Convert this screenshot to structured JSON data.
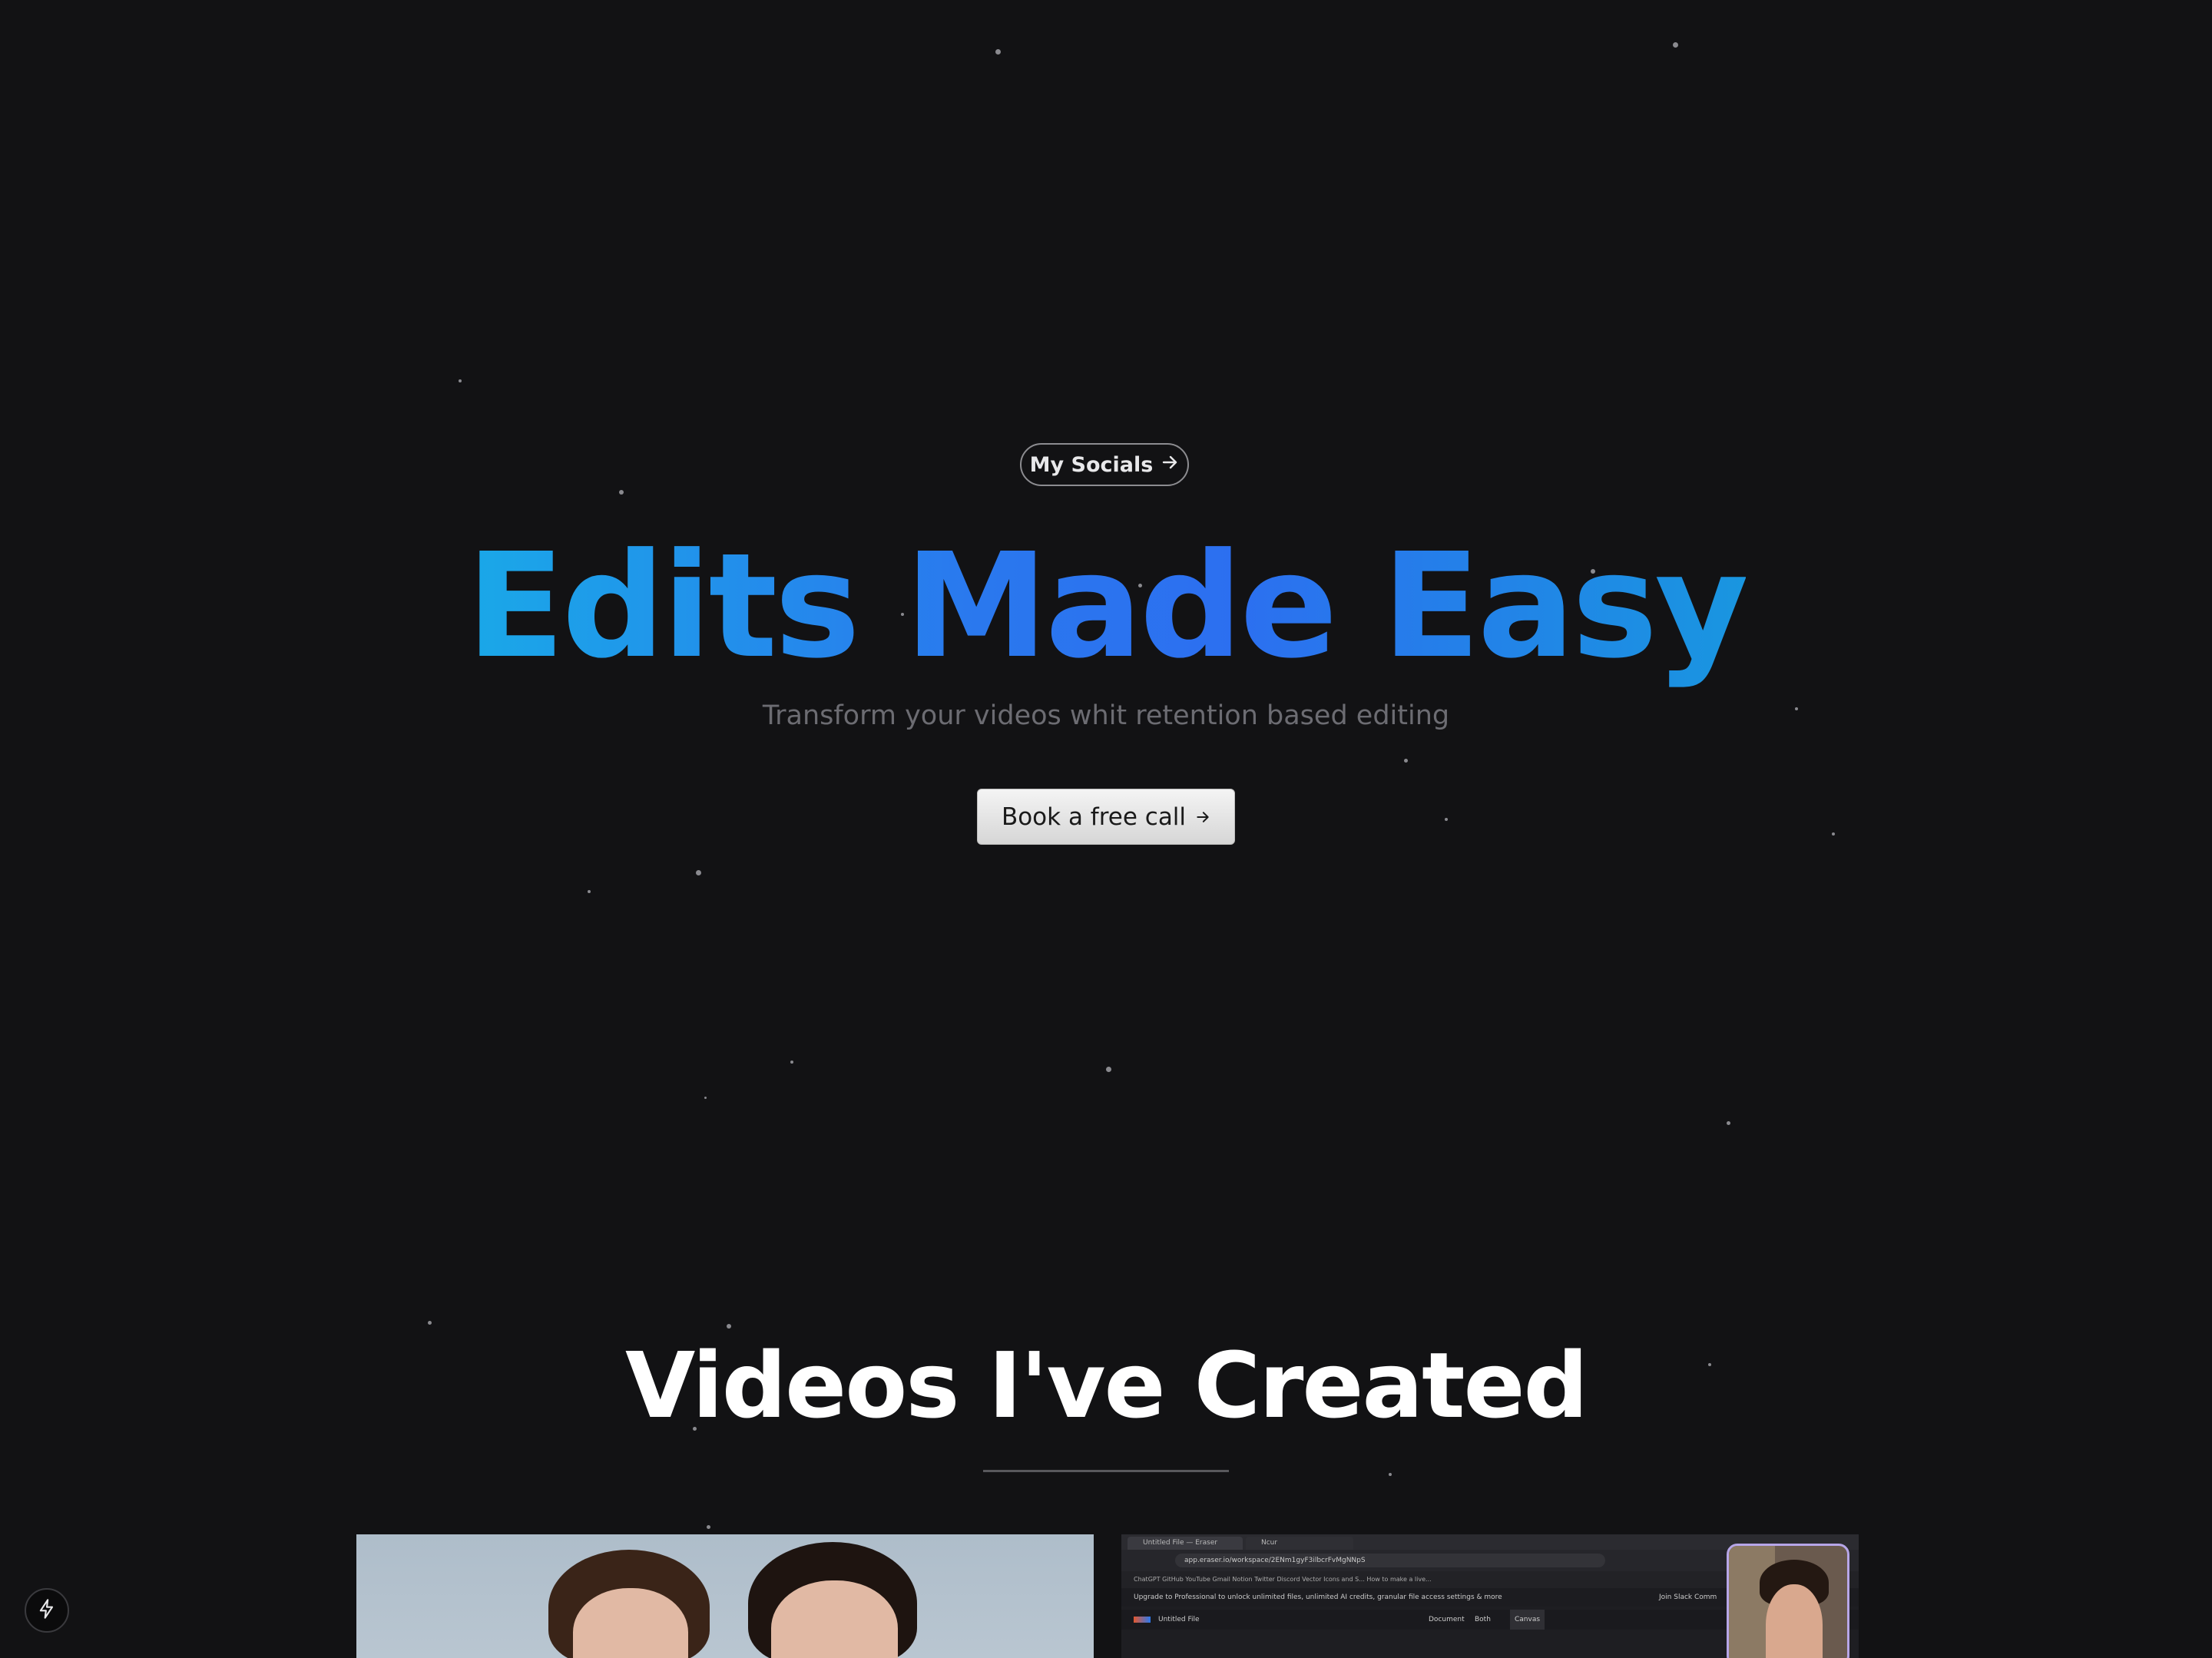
{
  "hero": {
    "socials_label": "My Socials",
    "socials_icon": "arrow-right-icon",
    "title": "Edits Made Easy",
    "subtitle": "Transform your videos whit retention based editing",
    "cta_label": "Book a free call",
    "cta_icon": "arrow-right-icon",
    "title_gradient": [
      "#1aa8e8",
      "#2a78ee",
      "#1996e0"
    ]
  },
  "videos_section": {
    "title": "Videos I've Created",
    "videos": [
      {
        "kind": "two-person-video-thumbnail"
      },
      {
        "kind": "screen-recording-thumbnail",
        "browser": {
          "tabs": [
            "Untitled File — Eraser",
            "Ncur"
          ],
          "url": "app.eraser.io/workspace/2ENm1gyF3ilbcrFvMgNNpS",
          "bookmarks": "ChatGPT   GitHub   YouTube   Gmail   Notion   Twitter   Discord   Vector Icons and S...   How to make a live...",
          "banner": "Upgrade to Professional to unlock unlimited files, unlimited AI credits, granular file access settings & more",
          "join_label": "Join Slack Comm",
          "file_name": "Untitled File",
          "view_tabs": [
            "Document",
            "Both",
            "Canvas"
          ]
        }
      }
    ]
  },
  "floating_button": {
    "icon": "lightning-bolt-icon"
  },
  "colors": {
    "background": "#121214",
    "accent_blue": "#2a78ee",
    "accent_cyan": "#1aa8e8"
  }
}
